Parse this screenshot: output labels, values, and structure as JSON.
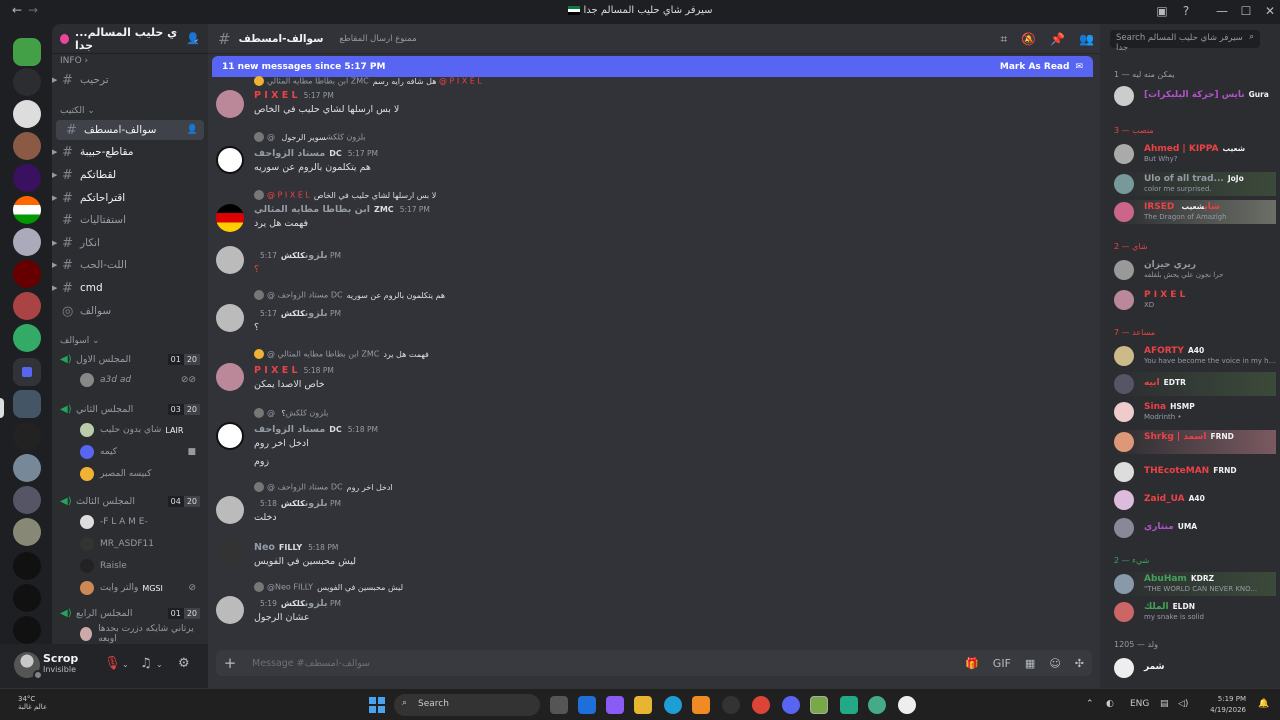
{
  "window": {
    "title": "سيرفر شاي حليب المسالم جدا",
    "back": "←",
    "forward": "→",
    "controls": [
      "—",
      "☐",
      "✕"
    ]
  },
  "server": {
    "name": "سيرفر شاي حليب المسالم جدا",
    "short_name": "...ي حليب المسالم جدا"
  },
  "sidebar": {
    "info_category": "INFO",
    "channels_top": [
      {
        "label": "ترحيب"
      }
    ],
    "kteeb_category": "الكتيب",
    "channels": [
      {
        "label": "سوالف-امسطف",
        "active": true
      },
      {
        "label": "مقاطع-حبيبة"
      },
      {
        "label": "لقطاتكم"
      },
      {
        "label": "اقتراحاتكم"
      },
      {
        "label": "استفتاليات"
      },
      {
        "label": "انكار"
      },
      {
        "label": "اللت-الحب"
      },
      {
        "label": "cmd"
      },
      {
        "label": "سوالف"
      }
    ],
    "voice_category": "اسوالف",
    "voice": [
      {
        "name": "المجلس الاول",
        "count": "01",
        "limit": "20",
        "users": [
          {
            "name": "a3d ad",
            "tag": ""
          }
        ]
      },
      {
        "name": "المجلس الثاني",
        "count": "03",
        "limit": "20",
        "users": [
          {
            "name": "شاي بدون حليب",
            "tag": "LAIR"
          },
          {
            "name": "كيمه",
            "tag": ""
          },
          {
            "name": "كبيسه المصبر",
            "tag": ""
          }
        ]
      },
      {
        "name": "المجلس الثالث",
        "count": "04",
        "limit": "20",
        "users": [
          {
            "name": "-F L A M E-",
            "tag": ""
          },
          {
            "name": "MR_ASDF11",
            "tag": ""
          },
          {
            "name": "Raisle",
            "tag": ""
          },
          {
            "name": "والتر وايت",
            "tag": "MGSI"
          }
        ]
      },
      {
        "name": "المجلس الرابع",
        "count": "01",
        "limit": "20",
        "users": [
          {
            "name": "يرتاني شايكه دزرت بحدها اوبعه",
            "tag": ""
          }
        ]
      }
    ]
  },
  "user": {
    "name": "Scrop",
    "status": "Invisible"
  },
  "chat": {
    "channel": "سوالف-امسطف",
    "topic": "ممنوع ارسال المقاطع",
    "new_messages": "11 new messages since 5:17 PM",
    "mark_read": "Mark As Read",
    "composer_placeholder": "Message #سوالف-امسطف",
    "messages": [
      {
        "reply_user": "@ P I X E L",
        "reply_text": "هل شافه رايه رسم",
        "reply_prefix": "ابن بطاطا مطايه المثالي ZMC",
        "author": "P I X E L",
        "author_color": "#ed4245",
        "badge": "",
        "time": "5:17 PM",
        "text": "لا بس ارسلها لشاي حليب في الخاص"
      },
      {
        "reply_user": "@ بلزون",
        "reply_text": "سوير الرجول",
        "reply_prefix": "كلكش",
        "author": "مستاد الزواحف",
        "author_color": "#949ba4",
        "badge": "DC",
        "time": "5:17 PM",
        "text": "هم يتكلمون بالروم عن سوريه"
      },
      {
        "reply_user": "@ P I X E L",
        "reply_text": "لا بس ارسلها لشاي حليب في الخاص",
        "reply_prefix": "",
        "author": "ابن بطاطا مطايه المثالي",
        "author_color": "#949ba4",
        "badge": "ZMC",
        "time": "5:17 PM",
        "text": "فهمت هل يرد"
      },
      {
        "reply_user": "",
        "reply_text": "",
        "reply_prefix": "",
        "author": "بلزون",
        "author_color": "#949ba4",
        "badge": "كلكش",
        "time": "5:17 PM",
        "text": "؟"
      },
      {
        "reply_user": "@ مستاد الزواحف",
        "reply_text": "هم يتكلمون بالروم عن سوريه",
        "reply_prefix": "DC",
        "author": "بلزون",
        "author_color": "#949ba4",
        "badge": "كلكش",
        "time": "5:17 PM",
        "text": "؟"
      },
      {
        "reply_user": "@ ابن بطاطا مطايه المثالي",
        "reply_text": "فهمت هل يرد",
        "reply_prefix": "ZMC",
        "author": "P I X E L",
        "author_color": "#ed4245",
        "badge": "",
        "time": "5:18 PM",
        "text": "خاص الاصدا يمكن"
      },
      {
        "reply_user": "@ بلزون",
        "reply_text": "؟",
        "reply_prefix": "كلكش",
        "author": "مستاد الزواحف",
        "author_color": "#949ba4",
        "badge": "DC",
        "time": "5:18 PM",
        "text": "ادخل اخر روم",
        "text2": "زوم"
      },
      {
        "reply_user": "@ مستاد الزواحف",
        "reply_text": "ادخل اخر روم",
        "reply_prefix": "DC",
        "author": "بلزون",
        "author_color": "#949ba4",
        "badge": "كلكش",
        "time": "5:18 PM",
        "text": "دخلت"
      },
      {
        "reply_user": "",
        "reply_text": "",
        "reply_prefix": "",
        "author": "Neo",
        "author_color": "#949ba4",
        "badge": "FILLY",
        "time": "5:18 PM",
        "text": "ليش محبسين في الفويس"
      },
      {
        "reply_user": "@Neo",
        "reply_text": "ليش محبسين في الفويس",
        "reply_prefix": "FILLY",
        "author": "بلزون",
        "author_color": "#949ba4",
        "badge": "كلكش",
        "time": "5:19 PM",
        "text": "عشان الرجول"
      }
    ]
  },
  "members": {
    "search_placeholder": "Search سيرفر شاي حليب المسالم جدا",
    "groups": [
      {
        "label": "يمكن منه ليه — 1",
        "items": [
          {
            "name": "نايس [حركة البلبكرات]",
            "color": "#b152c9",
            "badge": "Gura",
            "status": ""
          }
        ]
      },
      {
        "label": "منصب — 3",
        "items": [
          {
            "name": "Ahmed | KIPPA",
            "color": "#ed4245",
            "badge": "شعيب",
            "status": "But Why?"
          },
          {
            "name": "Ulo of all trad...",
            "color": "#949ba4",
            "badge": "JoJo",
            "status": "color me surprised."
          },
          {
            "name": "IRSED شاي",
            "color": "#ed4245",
            "badge": "شعيب",
            "status": "The Dragon of Amazigh"
          }
        ]
      },
      {
        "label": "شاي — 2",
        "items": [
          {
            "name": "ريري حيزان",
            "color": "#949ba4",
            "badge": "",
            "status": "حرا نجون علي يحش بلقلفه"
          },
          {
            "name": "P I X E L",
            "color": "#ed4245",
            "badge": "",
            "status": "XD"
          }
        ]
      },
      {
        "label": "مساعد — 7",
        "items": [
          {
            "name": "AFORTY",
            "color": "#ed4245",
            "badge": "A40",
            "status": "You have become the voice in my h..."
          },
          {
            "name": "ابيه",
            "color": "#ed4245",
            "badge": "EDTR",
            "status": ""
          },
          {
            "name": "Sina",
            "color": "#ed4245",
            "badge": "HSMP",
            "status": "Modrinth •"
          },
          {
            "name": "Shrkg | اسمد",
            "color": "#ed4245",
            "badge": "FRND",
            "status": ""
          },
          {
            "name": "THEcoteMAN",
            "color": "#ed4245",
            "badge": "FRND",
            "status": ""
          },
          {
            "name": "Zaid_UA",
            "color": "#ed4245",
            "badge": "A40",
            "status": ""
          },
          {
            "name": "منتاري",
            "color": "#ed4245",
            "badge": "UMA",
            "status": ""
          }
        ]
      },
      {
        "label": "شيء — 2",
        "items": [
          {
            "name": "AbuHam",
            "color": "#43a25a",
            "badge": "KDRZ",
            "status": "\"THE WORLD CAN NEVER KNO..."
          },
          {
            "name": "الملك",
            "color": "#43a25a",
            "badge": "ELDN",
            "status": "my snake is solid"
          }
        ]
      },
      {
        "label": "ولد — 1205",
        "items": [
          {
            "name": "شمر",
            "color": "#f2f3f5",
            "badge": "",
            "status": ""
          }
        ]
      }
    ]
  },
  "taskbar": {
    "weather_temp": "34°C",
    "weather_desc": "عالم غالبة",
    "search_label": "Search",
    "time": "5:19 PM",
    "date": "4/19/2026"
  },
  "colors": {
    "accent": "#5865f2",
    "online": "#23a55a",
    "danger": "#ed4245"
  }
}
